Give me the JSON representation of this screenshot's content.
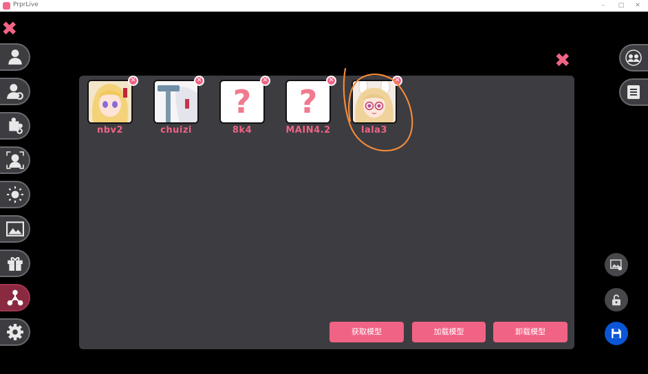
{
  "window": {
    "title": "PrprLive"
  },
  "models": [
    {
      "name": "nbv2",
      "thumbnail": "blonde-girl-avatar"
    },
    {
      "name": "chuizi",
      "thumbnail": "hammer-white-hair-avatar"
    },
    {
      "name": "8k4",
      "thumbnail": "question-mark"
    },
    {
      "name": "MAIN4.2",
      "thumbnail": "question-mark"
    },
    {
      "name": "lala3",
      "thumbnail": "bunny-ear-girl-glasses-avatar"
    }
  ],
  "actions": {
    "get_model": "获取模型",
    "load_model": "加载模型",
    "unload_model": "卸载模型"
  },
  "left_nav": [
    "user-icon",
    "user-settings-icon",
    "puzzle-settings-icon",
    "face-track-icon",
    "light-icon",
    "image-icon",
    "gift-icon",
    "network-icon",
    "gear-icon"
  ],
  "right_nav": [
    "group-icon",
    "list-icon"
  ],
  "tools": [
    "image-settings-icon",
    "unlock-icon",
    "save-icon"
  ],
  "colors": {
    "accent": "#f06384",
    "panel": "#3d3c41",
    "active_nav": "#8a2a40",
    "save_button": "#0b56d6",
    "annotation": "#f08a3a"
  }
}
